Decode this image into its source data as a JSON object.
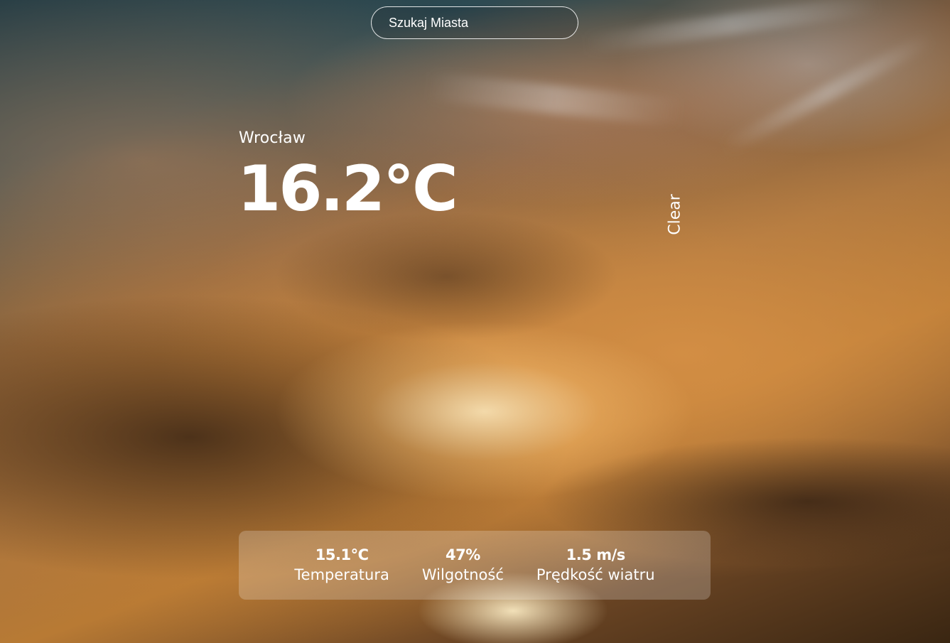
{
  "search": {
    "placeholder": "Szukaj Miasta"
  },
  "weather": {
    "city": "Wrocław",
    "temperature": "16.2°C",
    "condition": "Clear"
  },
  "details": [
    {
      "value": "15.1°C",
      "label": "Temperatura"
    },
    {
      "value": "47%",
      "label": "Wilgotność"
    },
    {
      "value": "1.5 m/s",
      "label": "Prędkość wiatru"
    }
  ]
}
